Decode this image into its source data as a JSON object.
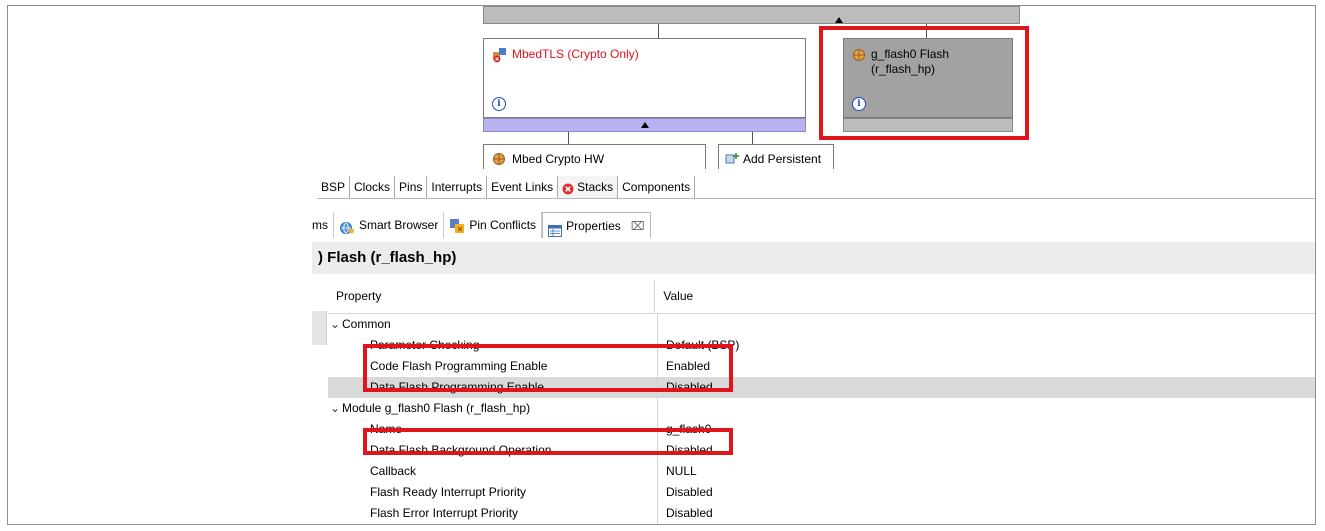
{
  "stacks": {
    "mbedtls_title": "MbedTLS (Crypto Only)",
    "flash_title_line1": "g_flash0 Flash",
    "flash_title_line2": "(r_flash_hp)",
    "info_glyph": "i",
    "mbed_crypto_hw": "Mbed Crypto HW",
    "add_persistent": "Add Persistent",
    "colors": {
      "error_text": "#e0141c",
      "highlight": "#e0141c",
      "purple_bar": "#b9b2f0"
    }
  },
  "editor_tabs": [
    {
      "label": "BSP"
    },
    {
      "label": "Clocks"
    },
    {
      "label": "Pins"
    },
    {
      "label": "Interrupts"
    },
    {
      "label": "Event Links"
    },
    {
      "label": "Stacks",
      "icon": "error-icon"
    },
    {
      "label": "Components"
    }
  ],
  "view_tabs": [
    {
      "label": "ms"
    },
    {
      "label": "Smart Browser",
      "icon": "smart-browser-icon"
    },
    {
      "label": "Pin Conflicts",
      "icon": "pin-conflicts-icon"
    },
    {
      "label": "Properties",
      "icon": "properties-icon",
      "close": "⌧"
    }
  ],
  "properties": {
    "header": ") Flash (r_flash_hp)",
    "col_property": "Property",
    "col_value": "Value",
    "group_common": "Common",
    "group_module": "Module g_flash0 Flash (r_flash_hp)",
    "rows": [
      {
        "name": "Parameter Checking",
        "value": "Default (BSP)"
      },
      {
        "name": "Code Flash Programming Enable",
        "value": "Enabled"
      },
      {
        "name": "Data Flash Programming Enable",
        "value": "Disabled"
      },
      {
        "name": "Name",
        "value": "g_flash0"
      },
      {
        "name": "Data Flash Background Operation",
        "value": "Disabled"
      },
      {
        "name": "Callback",
        "value": "NULL"
      },
      {
        "name": "Flash Ready Interrupt Priority",
        "value": "Disabled"
      },
      {
        "name": "Flash Error Interrupt Priority",
        "value": "Disabled"
      }
    ]
  }
}
